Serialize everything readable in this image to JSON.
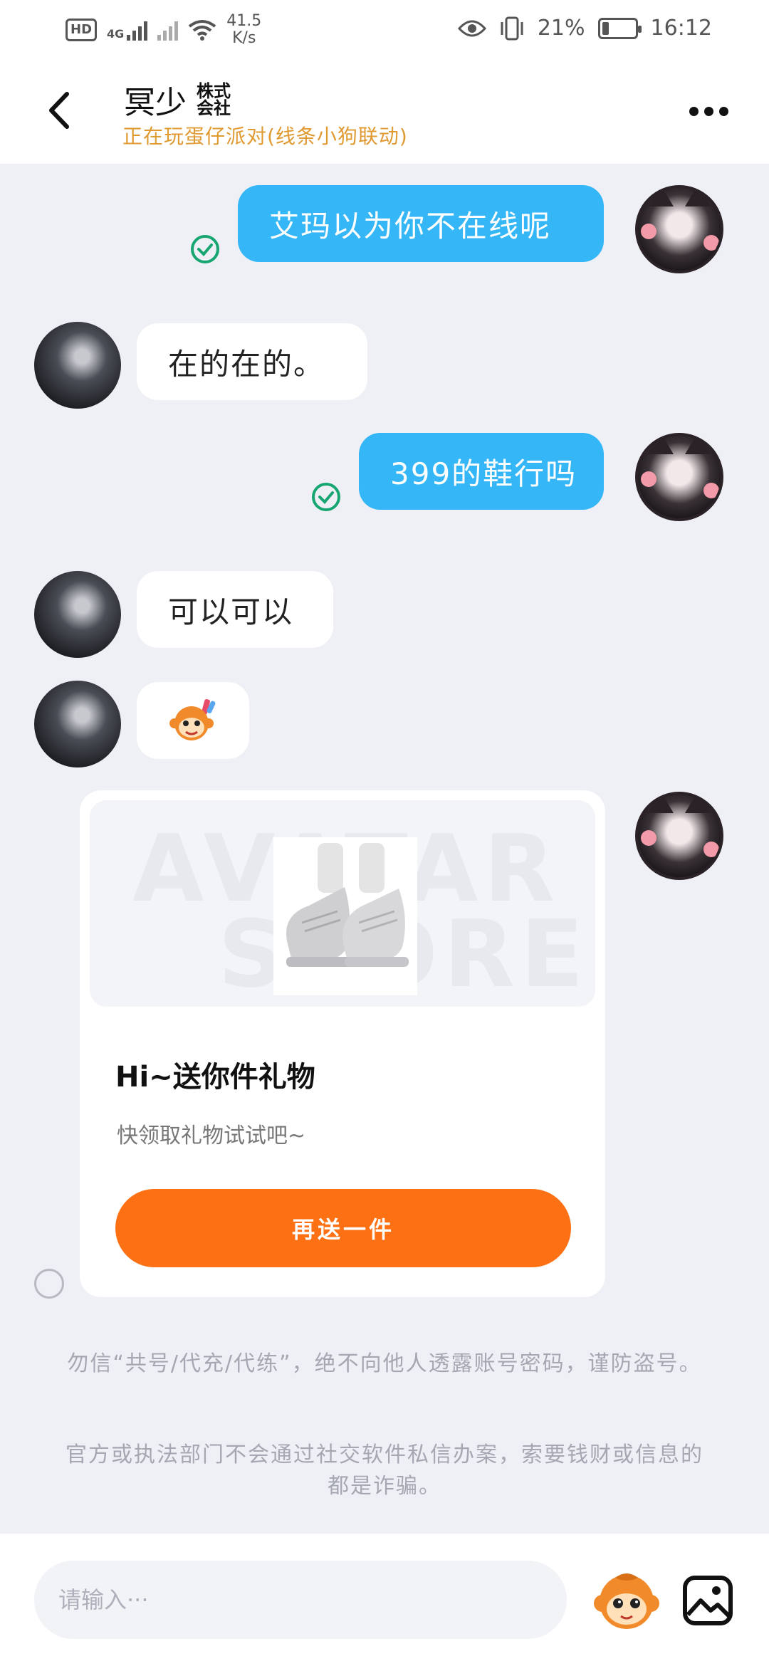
{
  "status_bar": {
    "hd_label": "HD",
    "network_label": "4G",
    "speed_value": "41.5",
    "speed_unit": "K/s",
    "battery_text": "21%",
    "battery_level": 0.21,
    "time": "16:12"
  },
  "header": {
    "title": "冥少",
    "tag_line1": "株式",
    "tag_line2": "会社",
    "subtitle": "正在玩蛋仔派对(线条小狗联动)"
  },
  "messages": [
    {
      "from": "me",
      "text": "艾玛以为你不在线呢",
      "read": true
    },
    {
      "from": "her",
      "text": "在的在的。"
    },
    {
      "from": "me",
      "text": "399的鞋行吗",
      "read": true
    },
    {
      "from": "her",
      "text": "可以可以"
    },
    {
      "from": "her",
      "type": "sticker",
      "icon": "monkey-sticker-icon"
    }
  ],
  "gift_card": {
    "banner_word_top": "AVATAR",
    "banner_word_bottom": "STORE",
    "image_icon": "sneaker-icon",
    "title": "Hi~送你件礼物",
    "description": "快领取礼物试试吧~",
    "button_label": "再送一件"
  },
  "notices": [
    "勿信“共号/代充/代练”，绝不向他人透露账号密码，谨防盗号。",
    "官方或执法部门不会通过社交软件私信办案，索要钱财或信息的都是诈骗。"
  ],
  "input": {
    "placeholder": "请输入···"
  },
  "colors": {
    "sent_bubble": "#35b6f7",
    "gift_button": "#fd7013",
    "subtitle": "#e09a32",
    "read_check": "#17a672"
  }
}
